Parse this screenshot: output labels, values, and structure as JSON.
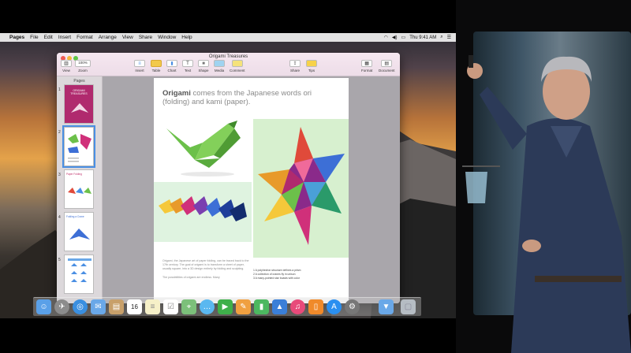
{
  "menubar": {
    "items": [
      "Pages",
      "File",
      "Edit",
      "Insert",
      "Format",
      "Arrange",
      "View",
      "Share",
      "Window",
      "Help"
    ],
    "clock": "Thu 9:41 AM"
  },
  "window": {
    "title": "Origami Treasures",
    "toolbar": {
      "view": "View",
      "zoom_value": "100%",
      "zoom": "Zoom",
      "insert": "Insert",
      "table": "Table",
      "chart": "Chart",
      "text": "Text",
      "shape": "Shape",
      "media": "Media",
      "comment": "Comment",
      "share": "Share",
      "tips": "Tips",
      "format": "Format",
      "document": "Document"
    },
    "sidebar": {
      "header": "Pages",
      "pages": [
        "1",
        "2",
        "3",
        "4",
        "5"
      ],
      "thumb_titles": [
        "ORIGAMI TREASURES",
        "",
        "Paper Folding",
        "Folding a Crane",
        ""
      ]
    }
  },
  "page": {
    "heading_bold": "Origami",
    "heading_rest": " comes from the Japanese words ori (folding) and kami (paper).",
    "body": "Origami, the Japanese art of paper folding, can be traced back to the 17th century. The goal of origami is to transform a sheet of paper, usually square, into a 3D design entirely by folding and sculpting.",
    "body2": "The possibilities of origami are endless. Many",
    "captions": [
      "1  A polyhedron structure defines a prism",
      "2  A collection of cranes fly in unison",
      "3  A many-pointed star boasts with color"
    ]
  },
  "dock": {
    "apps": [
      "finder-icon",
      "launchpad-icon",
      "safari-icon",
      "mail-icon",
      "contacts-icon",
      "calendar-icon",
      "notes-icon",
      "reminders-icon",
      "maps-icon",
      "messages-icon",
      "facetime-icon",
      "pages-icon",
      "numbers-icon",
      "keynote-icon",
      "itunes-icon",
      "ibooks-icon",
      "app-store-icon",
      "system-preferences-icon",
      "downloads-folder-icon",
      "trash-icon"
    ],
    "calendar_day": "16"
  },
  "colors": {
    "selection": "#4a8fe3",
    "crane_green": "#6cc04a",
    "star_magenta": "#d0307a"
  }
}
